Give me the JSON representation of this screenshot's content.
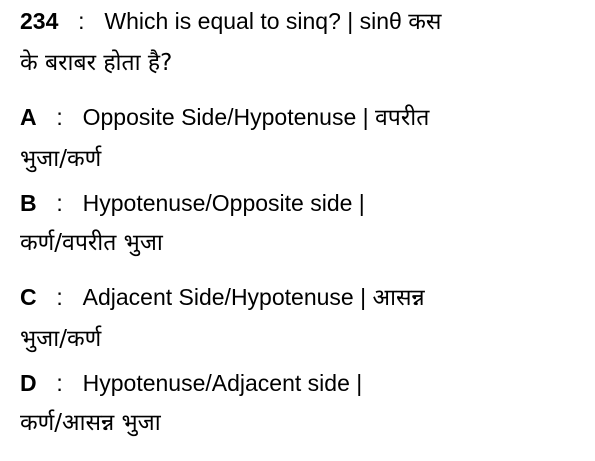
{
  "question": {
    "number": "234",
    "separator": ":",
    "text_line1": "Which is equal to sinq? | sinθ  कस",
    "text_line2": "के बराबर होता है?"
  },
  "options": [
    {
      "letter": "A",
      "separator": ":",
      "line1": "Opposite Side/Hypotenuse |  वपरीत",
      "line2": "भुजा/कर्ण"
    },
    {
      "letter": "B",
      "separator": ":",
      "line1": "Hypotenuse/Opposite side |",
      "line2": "कर्ण/वपरीत भुजा"
    },
    {
      "letter": "C",
      "separator": ":",
      "line1": "Adjacent Side/Hypotenuse | आसन्न",
      "line2": "भुजा/कर्ण"
    },
    {
      "letter": "D",
      "separator": ":",
      "line1": "Hypotenuse/Adjacent side |",
      "line2": "कर्ण/आसन्न भुजा"
    }
  ]
}
